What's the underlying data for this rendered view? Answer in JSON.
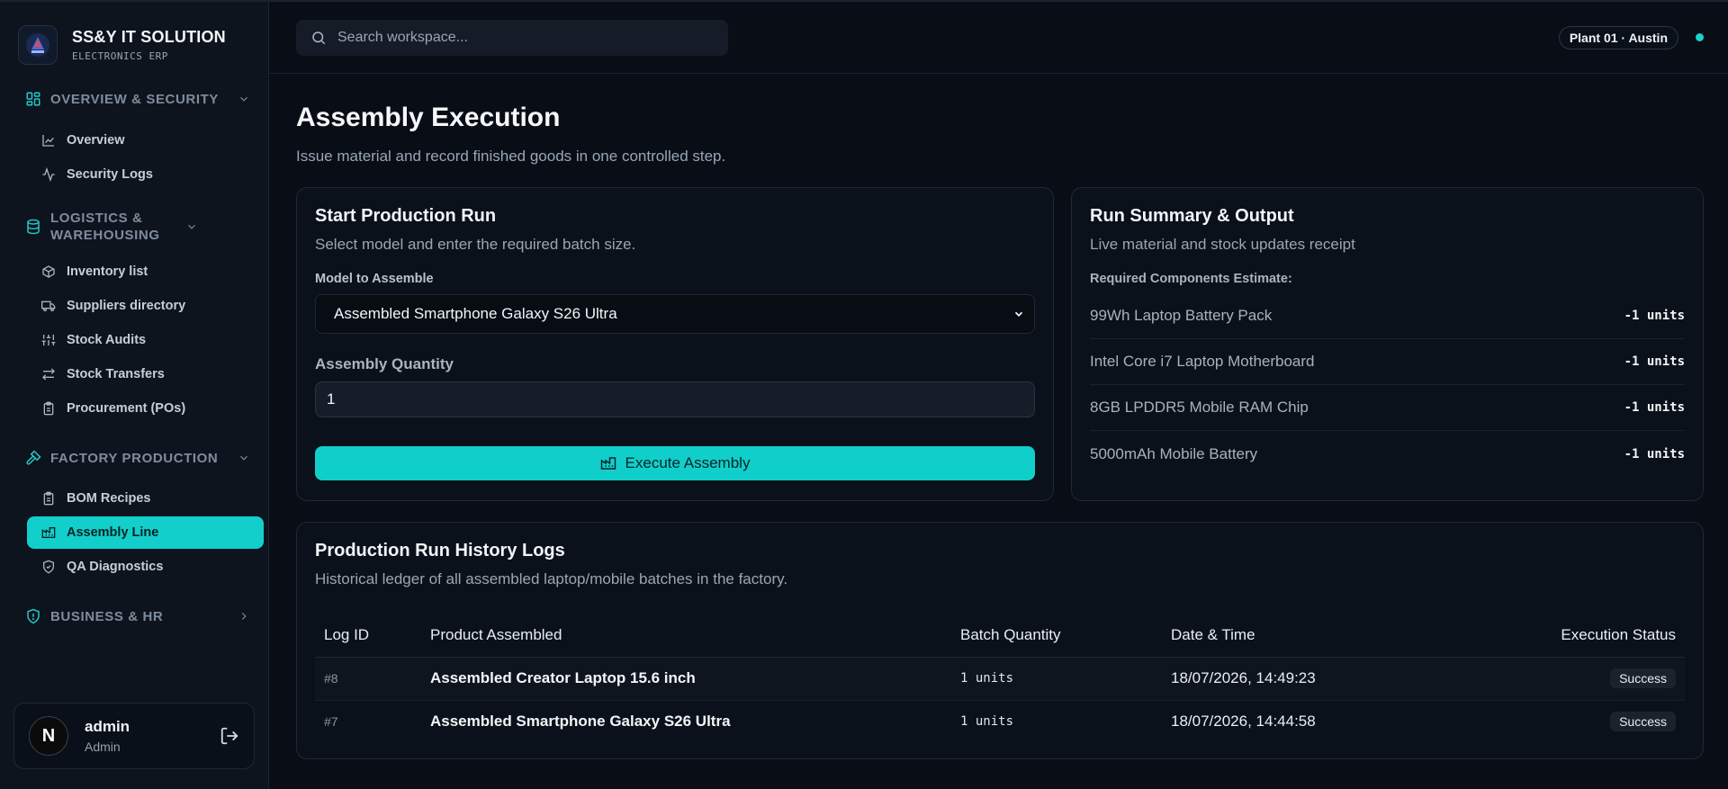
{
  "brand": {
    "name": "SS&Y IT SOLUTION",
    "subtitle": "ELECTRONICS ERP"
  },
  "sidebar": {
    "sections": [
      {
        "label": "OVERVIEW & SECURITY",
        "icon": "dashboard-icon",
        "items": [
          {
            "label": "Overview",
            "icon": "chart-icon"
          },
          {
            "label": "Security Logs",
            "icon": "activity-icon"
          }
        ]
      },
      {
        "label": "LOGISTICS & WAREHOUSING",
        "icon": "database-icon",
        "items": [
          {
            "label": "Inventory list",
            "icon": "package-icon"
          },
          {
            "label": "Suppliers directory",
            "icon": "truck-icon"
          },
          {
            "label": "Stock Audits",
            "icon": "sliders-icon"
          },
          {
            "label": "Stock Transfers",
            "icon": "arrows-icon"
          },
          {
            "label": "Procurement (POs)",
            "icon": "clipboard-icon"
          }
        ]
      },
      {
        "label": "FACTORY PRODUCTION",
        "icon": "hammer-icon",
        "items": [
          {
            "label": "BOM Recipes",
            "icon": "clipboard-icon"
          },
          {
            "label": "Assembly Line",
            "icon": "factory-icon",
            "active": true
          },
          {
            "label": "QA Diagnostics",
            "icon": "shield-check-icon"
          }
        ]
      },
      {
        "label": "BUSINESS & HR",
        "icon": "shield-icon",
        "items": []
      }
    ]
  },
  "user": {
    "name": "admin",
    "role": "Admin",
    "avatar_letter": "N"
  },
  "search": {
    "placeholder": "Search workspace..."
  },
  "topbar": {
    "plant": "Plant 01 · Austin"
  },
  "page": {
    "title": "Assembly Execution",
    "subtitle": "Issue material and record finished goods in one controlled step."
  },
  "start_run": {
    "title": "Start Production Run",
    "subtitle": "Select model and enter the required batch size.",
    "model_label": "Model to Assemble",
    "model_value": "Assembled Smartphone Galaxy S26 Ultra",
    "qty_label": "Assembly Quantity",
    "qty_value": "1",
    "button_label": "Execute Assembly"
  },
  "summary": {
    "title": "Run Summary & Output",
    "subtitle": "Live material and stock updates receipt",
    "req_label": "Required Components Estimate:",
    "components": [
      {
        "name": "99Wh Laptop Battery Pack",
        "qty": "-1 units"
      },
      {
        "name": "Intel Core i7 Laptop Motherboard",
        "qty": "-1 units"
      },
      {
        "name": "8GB LPDDR5 Mobile RAM Chip",
        "qty": "-1 units"
      },
      {
        "name": "5000mAh Mobile Battery",
        "qty": "-1 units"
      }
    ]
  },
  "history": {
    "title": "Production Run History Logs",
    "subtitle": "Historical ledger of all assembled laptop/mobile batches in the factory.",
    "columns": [
      "Log ID",
      "Product Assembled",
      "Batch Quantity",
      "Date & Time",
      "Execution Status"
    ],
    "rows": [
      {
        "id": "#8",
        "product": "Assembled Creator Laptop 15.6 inch",
        "qty": "1 units",
        "date": "18/07/2026, 14:49:23",
        "status": "Success"
      },
      {
        "id": "#7",
        "product": "Assembled Smartphone Galaxy S26 Ultra",
        "qty": "1 units",
        "date": "18/07/2026, 14:44:58",
        "status": "Success"
      }
    ]
  },
  "colors": {
    "accent": "#12cfcb",
    "background": "#080d16",
    "sidebar": "#0d141e"
  }
}
